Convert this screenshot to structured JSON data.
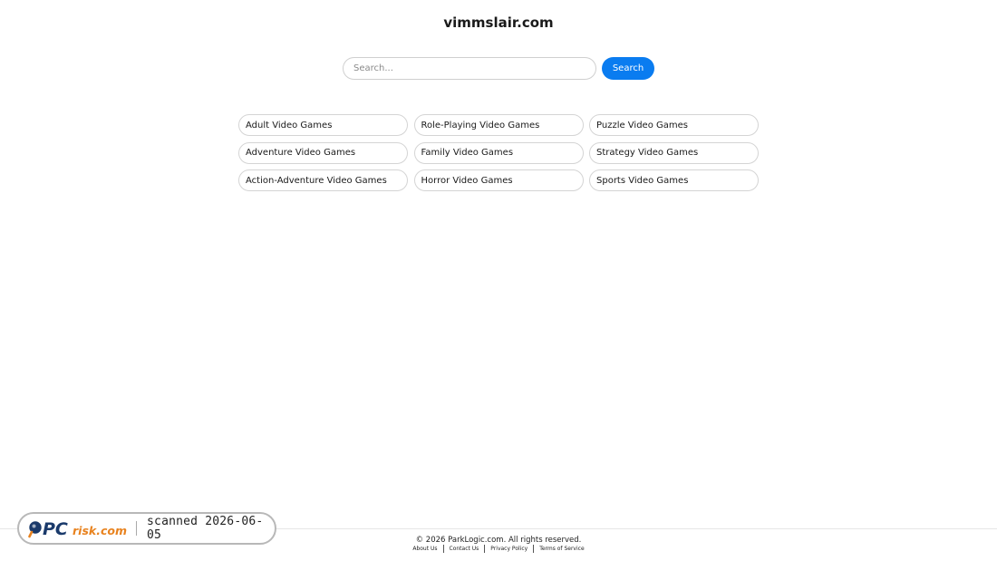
{
  "site": {
    "title": "vimmslair.com"
  },
  "search": {
    "placeholder": "Search...",
    "button_label": "Search",
    "accent_color": "#0a7cf0"
  },
  "categories": [
    "Adult Video Games",
    "Role-Playing Video Games",
    "Puzzle Video Games",
    "Adventure Video Games",
    "Family Video Games",
    "Strategy Video Games",
    "Action-Adventure Video Games",
    "Horror Video Games",
    "Sports Video Games"
  ],
  "footer": {
    "copyright": "© 2026 ParkLogic.com. All rights reserved.",
    "links": [
      "About Us",
      "Contact Us",
      "Privacy Policy",
      "Terms of Service"
    ]
  },
  "watermark": {
    "logo_text": "PCrisk.com",
    "scan_text": "scanned 2026-06-05",
    "logo_colors": {
      "pc": "#1a3a6b",
      "risk": "#e8821e"
    }
  }
}
